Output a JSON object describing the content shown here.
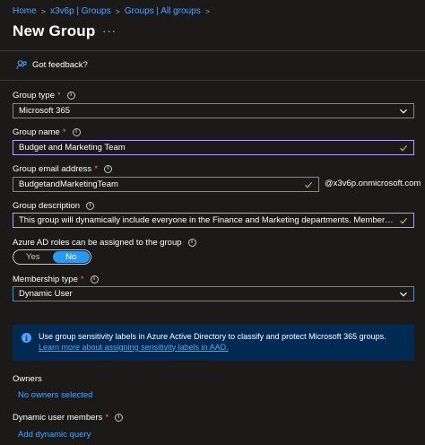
{
  "breadcrumb": {
    "items": [
      "Home",
      "x3v6p | Groups",
      "Groups | All groups"
    ],
    "separator": ">"
  },
  "page": {
    "title": "New Group",
    "more_label": "···"
  },
  "feedback": {
    "label": "Got feedback?",
    "icon": "feedback-person-icon"
  },
  "form": {
    "group_type": {
      "label": "Group type",
      "required": "*",
      "value": "Microsoft 365"
    },
    "group_name": {
      "label": "Group name",
      "required": "*",
      "value": "Budget and Marketing Team"
    },
    "group_email": {
      "label": "Group email address",
      "required": "*",
      "value": "BudgetandMarketingTeam",
      "domain": "@x3v6p.onmicrosoft.com"
    },
    "group_description": {
      "label": "Group description",
      "value": "This group will dynamically include everyone in the Finance and Marketing departments. Members will be pa..."
    },
    "azure_roles": {
      "label": "Azure AD roles can be assigned to the group",
      "options": [
        "Yes",
        "No"
      ],
      "selected": "No"
    },
    "membership_type": {
      "label": "Membership type",
      "required": "*",
      "value": "Dynamic User"
    }
  },
  "banner": {
    "text": "Use group sensitivity labels in Azure Active Directory to classify and protect Microsoft 365 groups. ",
    "link_text": "Learn more about assigning sensitivity labels in AAD."
  },
  "owners": {
    "label": "Owners",
    "link": "No owners selected"
  },
  "dynamic_members": {
    "label": "Dynamic user members",
    "required": "*",
    "link": "Add dynamic query"
  },
  "info_glyph": "i",
  "colors": {
    "background": "#1b1a19",
    "link": "#4da3ff",
    "required": "#f1707b",
    "focus_border": "#b4a0ff",
    "accent": "#2899f5",
    "banner_bg": "#002a52",
    "valid_check": "#92c353"
  }
}
